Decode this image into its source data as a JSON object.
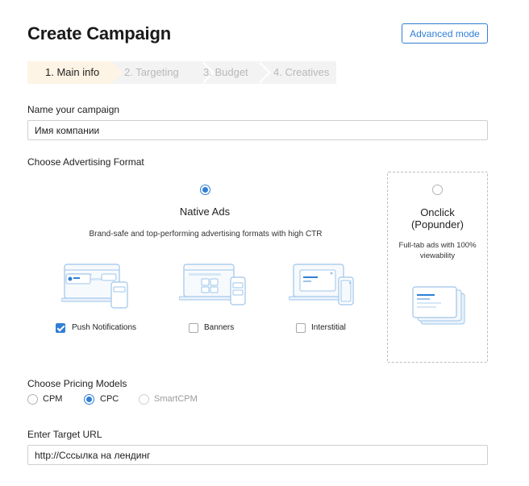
{
  "header": {
    "title": "Create Campaign",
    "advanced_mode": "Advanced mode"
  },
  "steps": [
    {
      "label": "1. Main info",
      "active": true
    },
    {
      "label": "2. Targeting",
      "active": false
    },
    {
      "label": "3. Budget",
      "active": false
    },
    {
      "label": "4. Creatives",
      "active": false
    }
  ],
  "campaign_name": {
    "label": "Name your campaign",
    "value": "Имя компании"
  },
  "ad_format": {
    "label": "Choose Advertising Format",
    "native": {
      "title": "Native Ads",
      "description": "Brand-safe and top-performing advertising formats with high CTR",
      "selected": true,
      "subformats": [
        {
          "label": "Push Notifications",
          "checked": true,
          "icon": "push-notifications-illustration"
        },
        {
          "label": "Banners",
          "checked": false,
          "icon": "banners-illustration"
        },
        {
          "label": "Interstitial",
          "checked": false,
          "icon": "interstitial-illustration"
        }
      ]
    },
    "onclick": {
      "title_line1": "Onclick",
      "title_line2": "(Popunder)",
      "description": "Full-tab ads with 100% viewability",
      "selected": false,
      "icon": "popunder-illustration"
    }
  },
  "pricing": {
    "label": "Choose Pricing Models",
    "options": [
      {
        "label": "CPM",
        "selected": false,
        "disabled": false
      },
      {
        "label": "CPC",
        "selected": true,
        "disabled": false
      },
      {
        "label": "SmartCPM",
        "selected": false,
        "disabled": true
      }
    ]
  },
  "target_url": {
    "label": "Enter Target URL",
    "value": "http://Сссылка на лендинг"
  },
  "colors": {
    "accent": "#2f7fd6",
    "active_step_bg": "#fdf4e6",
    "illustration_stroke": "#9ec4ea"
  }
}
